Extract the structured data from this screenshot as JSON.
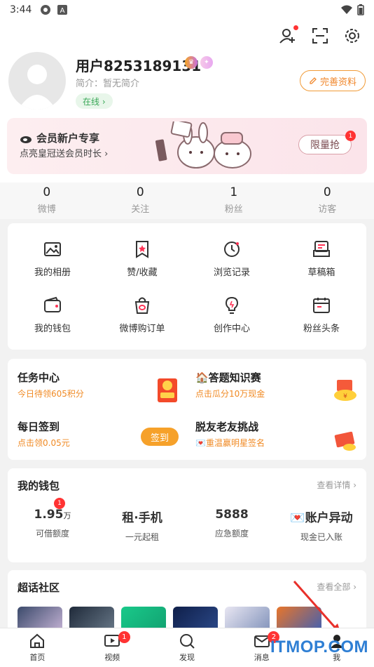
{
  "status": {
    "time": "3:44"
  },
  "profile": {
    "username": "用户8253189131",
    "bio": "简介：暂无简介",
    "online": "在线 ›",
    "edit_label": "完善资料"
  },
  "vip": {
    "title": "会员新户专享",
    "subtitle": "点亮皇冠送会员时长 ›",
    "button": "限量抢",
    "badge": "1"
  },
  "stats": [
    {
      "num": "0",
      "label": "微博"
    },
    {
      "num": "0",
      "label": "关注"
    },
    {
      "num": "1",
      "label": "粉丝"
    },
    {
      "num": "0",
      "label": "访客"
    }
  ],
  "grid": [
    {
      "label": "我的相册",
      "icon": "photo-album-icon"
    },
    {
      "label": "赞/收藏",
      "icon": "favorite-icon"
    },
    {
      "label": "浏览记录",
      "icon": "history-icon"
    },
    {
      "label": "草稿箱",
      "icon": "drafts-icon"
    },
    {
      "label": "我的钱包",
      "icon": "wallet-icon"
    },
    {
      "label": "微博购订单",
      "icon": "shopping-bag-icon"
    },
    {
      "label": "创作中心",
      "icon": "lightbulb-icon"
    },
    {
      "label": "粉丝头条",
      "icon": "headline-icon"
    }
  ],
  "tasks": [
    {
      "title": "任务中心",
      "sub": "今日待领605积分"
    },
    {
      "title": "🏠答题知识赛",
      "sub": "点击瓜分10万现金"
    },
    {
      "title": "每日签到",
      "sub": "点击领0.05元",
      "button": "签到"
    },
    {
      "title": "脱友老友挑战",
      "sub": "💌重温赢明星签名"
    }
  ],
  "wallet": {
    "title": "我的钱包",
    "more": "查看详情 ›",
    "items": [
      {
        "value": "1.95",
        "unit": "万",
        "sub": "可借额度",
        "badge": "1"
      },
      {
        "value": "租·手机",
        "unit": "",
        "sub": "一元起租"
      },
      {
        "value": "5888",
        "unit": "",
        "sub": "应急额度"
      },
      {
        "value": "💌账户异动",
        "unit": "",
        "sub": "现金已入账"
      }
    ]
  },
  "topics": {
    "title": "超话社区",
    "more": "查看全部 ›"
  },
  "tabs": [
    {
      "label": "首页"
    },
    {
      "label": "视频",
      "badge": "1"
    },
    {
      "label": "发现"
    },
    {
      "label": "消息",
      "badge": "2"
    },
    {
      "label": "我"
    }
  ],
  "watermark": "ITMOP.COM"
}
